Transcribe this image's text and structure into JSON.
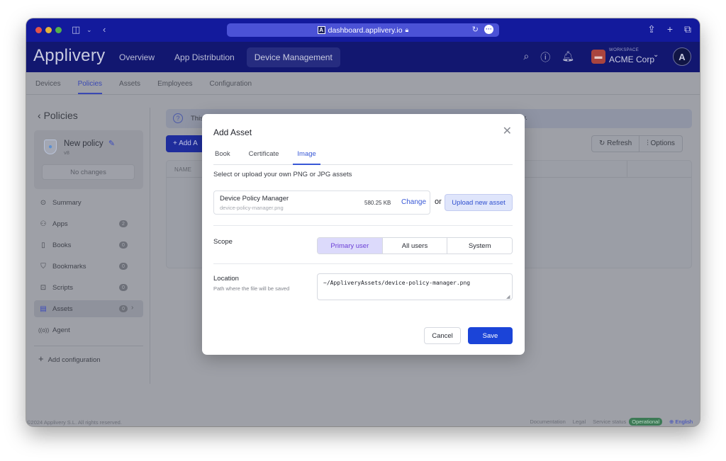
{
  "browser": {
    "url": "dashboard.applivery.io",
    "icons": [
      "sidebar-toggle-icon",
      "chevron-down-icon",
      "back-icon",
      "lock-icon",
      "reload-icon",
      "more-icon",
      "share-icon",
      "new-tab-icon",
      "tabs-overview-icon"
    ]
  },
  "app": {
    "logo": "Applivery",
    "nav": [
      {
        "label": "Overview",
        "active": false
      },
      {
        "label": "App Distribution",
        "active": false
      },
      {
        "label": "Device Management",
        "active": true
      }
    ],
    "workspace_label": "WORKSPACE",
    "workspace_name": "ACME Corp",
    "avatar_letter": "A"
  },
  "subnav": [
    {
      "label": "Devices",
      "active": false
    },
    {
      "label": "Policies",
      "active": true
    },
    {
      "label": "Assets",
      "active": false
    },
    {
      "label": "Employees",
      "active": false
    },
    {
      "label": "Configuration",
      "active": false
    }
  ],
  "sidebar": {
    "back_label": "Policies",
    "policy_name": "New policy",
    "policy_version": "v8",
    "no_changes_label": "No changes",
    "items": [
      {
        "label": "Summary",
        "icon": "✓",
        "badge": null
      },
      {
        "label": "Apps",
        "icon": "⚇",
        "badge": "2"
      },
      {
        "label": "Books",
        "icon": "▯",
        "badge": "0"
      },
      {
        "label": "Bookmarks",
        "icon": "⛉",
        "badge": "0"
      },
      {
        "label": "Scripts",
        "icon": "⌨",
        "badge": "0"
      },
      {
        "label": "Assets",
        "icon": "▤",
        "badge": "0",
        "active": true
      },
      {
        "label": "Agent",
        "icon": "((o))",
        "badge": null
      }
    ],
    "add_configuration": "Add configuration"
  },
  "content": {
    "info_text": "This",
    "info_tail": "y.",
    "add_button": "+ Add A",
    "refresh_label": "Refresh",
    "options_label": "Options",
    "table_header": "NAME"
  },
  "footer": {
    "copyright": "©2024 Applivery S.L. All rights reserved.",
    "links": [
      "Documentation",
      "Legal",
      "Service status"
    ],
    "status": "Operational",
    "status_color": "#3d7a56",
    "language": "English"
  },
  "modal": {
    "title": "Add Asset",
    "tabs": [
      {
        "label": "Book",
        "active": false
      },
      {
        "label": "Certificate",
        "active": false
      },
      {
        "label": "Image",
        "active": true
      }
    ],
    "description": "Select or upload your own PNG or JPG assets",
    "asset": {
      "name": "Device Policy Manager",
      "file": "device-policy-manager.png",
      "size": "580.25 KB",
      "change_label": "Change"
    },
    "or_label": "or",
    "upload_label": "Upload new asset",
    "scope": {
      "label": "Scope",
      "options": [
        {
          "label": "Primary user",
          "active": true
        },
        {
          "label": "All users",
          "active": false
        },
        {
          "label": "System",
          "active": false
        }
      ]
    },
    "location": {
      "label": "Location",
      "sublabel": "Path where the file will be saved",
      "value": "~/AppliveryAssets/device-policy-manager.png"
    },
    "cancel_label": "Cancel",
    "save_label": "Save",
    "accent_color": "#1b44d8"
  }
}
